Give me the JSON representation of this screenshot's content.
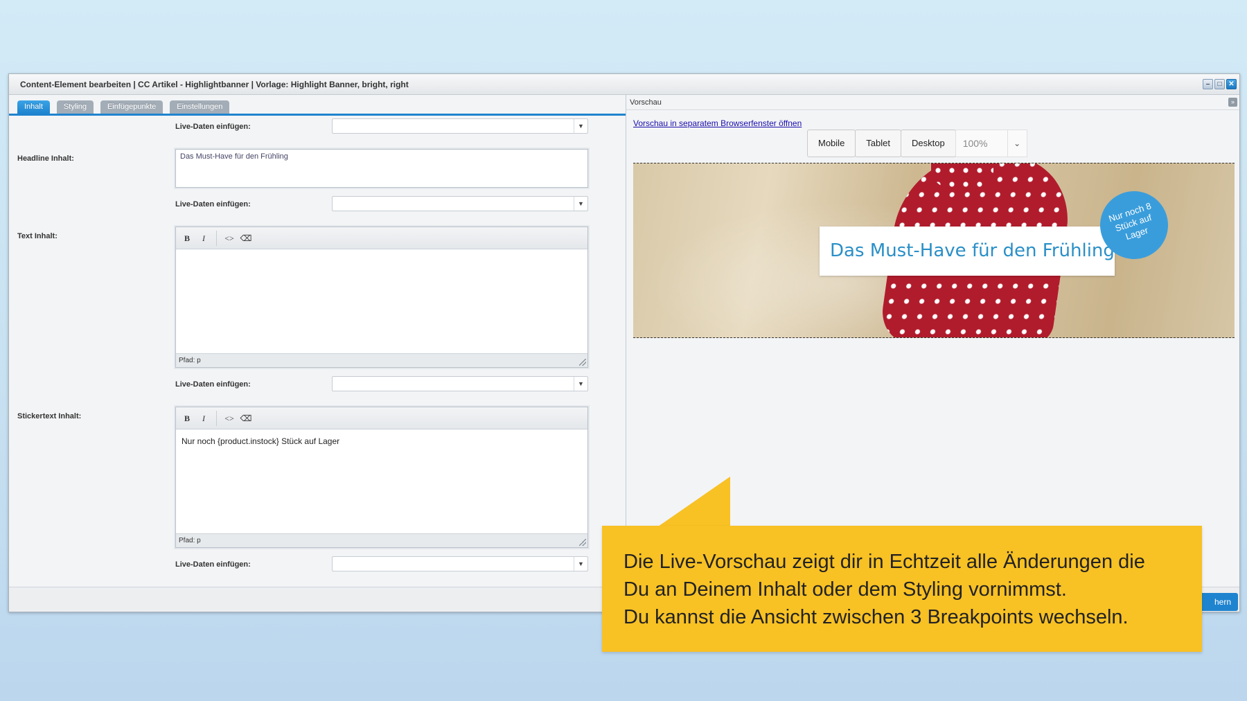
{
  "window": {
    "title": "Content-Element bearbeiten | CC Artikel - Highlightbanner | Vorlage: Highlight Banner, bright, right",
    "controls": [
      "minimize-icon",
      "maximize-icon",
      "close-icon"
    ]
  },
  "tabs": [
    {
      "label": "Inhalt",
      "active": true
    },
    {
      "label": "Styling",
      "active": false
    },
    {
      "label": "Einfügepunkte",
      "active": false
    },
    {
      "label": "Einstellungen",
      "active": false
    }
  ],
  "form": {
    "live_data_label": "Live-Daten einfügen:",
    "headline_label": "Headline Inhalt:",
    "headline_value": "Das Must-Have für den Frühling",
    "text_label": "Text Inhalt:",
    "text_value": "",
    "text_path": "Pfad: p",
    "sticker_label": "Stickertext Inhalt:",
    "sticker_value": "Nur noch {product.instock} Stück auf Lager",
    "sticker_path": "Pfad: p",
    "toolbar": {
      "bold": "B",
      "italic": "I",
      "code": "<>",
      "eraser": "⌫"
    }
  },
  "preview": {
    "header": "Vorschau",
    "collapse": "»",
    "open_link": "Vorschau in separatem Browserfenster öffnen",
    "breakpoints": [
      "Mobile",
      "Tablet",
      "Desktop"
    ],
    "zoom": "100%",
    "banner_headline": "Das Must-Have für den Frühling",
    "sticker_lines": [
      "Nur noch 8",
      "Stück auf",
      "Lager"
    ]
  },
  "bottom": {
    "save_label": "hern"
  },
  "callout": {
    "line1": "Die Live-Vorschau zeigt dir in Echtzeit alle Änderungen die",
    "line2": "Du an Deinem Inhalt oder dem Styling vornimmst.",
    "line3": "Du kannst die Ansicht zwischen 3 Breakpoints wechseln."
  },
  "colors": {
    "accent": "#1f84cf",
    "callout": "#f8c124",
    "headline": "#2a8fc7"
  }
}
